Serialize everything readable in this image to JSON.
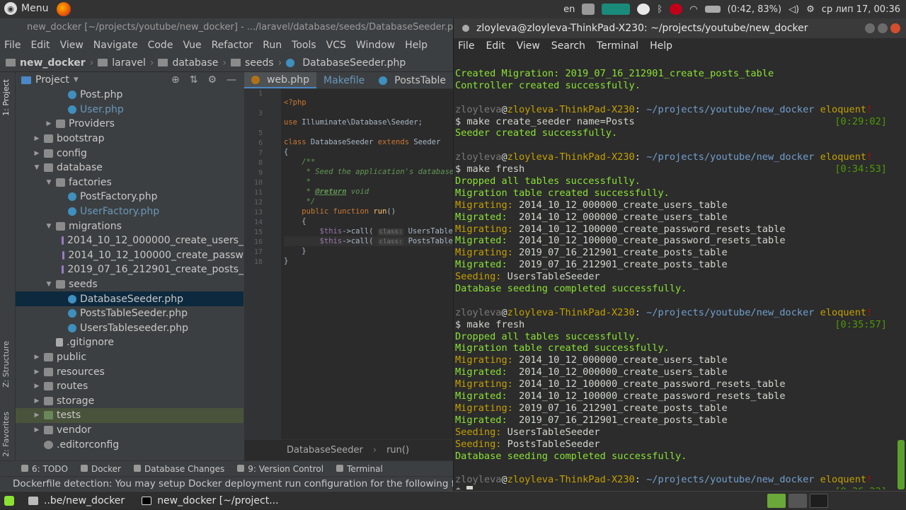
{
  "system": {
    "menu_label": "Menu",
    "lang": "en",
    "battery": "(0:42, 83%)",
    "datetime": "ср лип 17, 00:36"
  },
  "ide": {
    "window_title": "new_docker [~/projects/youtube/new_docker] - .../laravel/database/seeds/DatabaseSeeder.php",
    "menu": [
      "File",
      "Edit",
      "View",
      "Navigate",
      "Code",
      "Vue",
      "Refactor",
      "Run",
      "Tools",
      "VCS",
      "Window",
      "Help"
    ],
    "breadcrumbs": [
      "new_docker",
      "laravel",
      "database",
      "seeds",
      "DatabaseSeeder.php"
    ],
    "project_label": "Project",
    "side_tabs": [
      "1: Project",
      "Z: Structure",
      "2: Favorites"
    ],
    "tree": [
      {
        "label": "Post.php",
        "type": "php",
        "depth": 4
      },
      {
        "label": "User.php",
        "type": "php",
        "depth": 4,
        "color": "blue"
      },
      {
        "label": "Providers",
        "type": "folder",
        "depth": 3,
        "arrow": "right"
      },
      {
        "label": "bootstrap",
        "type": "folder",
        "depth": 2,
        "arrow": "right"
      },
      {
        "label": "config",
        "type": "folder",
        "depth": 2,
        "arrow": "right"
      },
      {
        "label": "database",
        "type": "folder",
        "depth": 2,
        "arrow": "down"
      },
      {
        "label": "factories",
        "type": "folder",
        "depth": 3,
        "arrow": "down"
      },
      {
        "label": "PostFactory.php",
        "type": "php",
        "depth": 4
      },
      {
        "label": "UserFactory.php",
        "type": "php",
        "depth": 4,
        "color": "blue"
      },
      {
        "label": "migrations",
        "type": "folder",
        "depth": 3,
        "arrow": "down"
      },
      {
        "label": "2014_10_12_000000_create_users_",
        "type": "mig",
        "depth": 4
      },
      {
        "label": "2014_10_12_100000_create_passw",
        "type": "mig",
        "depth": 4
      },
      {
        "label": "2019_07_16_212901_create_posts_",
        "type": "mig",
        "depth": 4
      },
      {
        "label": "seeds",
        "type": "folder",
        "depth": 3,
        "arrow": "down"
      },
      {
        "label": "DatabaseSeeder.php",
        "type": "php",
        "depth": 4,
        "selected": true
      },
      {
        "label": "PostsTableSeeder.php",
        "type": "php",
        "depth": 4
      },
      {
        "label": "UsersTableseeder.php",
        "type": "php",
        "depth": 4
      },
      {
        "label": ".gitignore",
        "type": "file",
        "depth": 3
      },
      {
        "label": "public",
        "type": "folder",
        "depth": 2,
        "arrow": "right"
      },
      {
        "label": "resources",
        "type": "folder",
        "depth": 2,
        "arrow": "right"
      },
      {
        "label": "routes",
        "type": "folder",
        "depth": 2,
        "arrow": "right"
      },
      {
        "label": "storage",
        "type": "folder",
        "depth": 2,
        "arrow": "right"
      },
      {
        "label": "tests",
        "type": "tests",
        "depth": 2,
        "arrow": "right",
        "highlight": true
      },
      {
        "label": "vendor",
        "type": "folder",
        "depth": 2,
        "arrow": "right"
      },
      {
        "label": ".editorconfig",
        "type": "cfg",
        "depth": 2
      }
    ],
    "tabs": [
      "web.php",
      "Makefile",
      "PostsTable"
    ],
    "line_numbers": [
      "1",
      "",
      "3",
      "",
      "5",
      "6",
      "7",
      "8",
      "9",
      "10",
      "11",
      "12",
      "13",
      "14",
      "15",
      "16",
      "17",
      "18"
    ],
    "code_crumb": [
      "DatabaseSeeder",
      "run()"
    ],
    "toolbar": [
      "6: TODO",
      "Docker",
      "Database Changes",
      "9: Version Control",
      "Terminal"
    ],
    "status": "Dockerfile detection: You may setup Docker deployment run configuration for the following file"
  },
  "terminal": {
    "title": "zloyleva@zloyleva-ThinkPad-X230: ~/projects/youtube/new_docker",
    "menu": [
      "File",
      "Edit",
      "View",
      "Search",
      "Terminal",
      "Help"
    ],
    "prompt_user": "zloyleva",
    "prompt_host": "zloyleva-ThinkPad-X230",
    "prompt_path": "~/projects/youtube/new_docker",
    "prompt_branch": "eloquent"
  },
  "taskbar": {
    "items": [
      "..be/new_docker",
      "new_docker [~/project..."
    ]
  }
}
